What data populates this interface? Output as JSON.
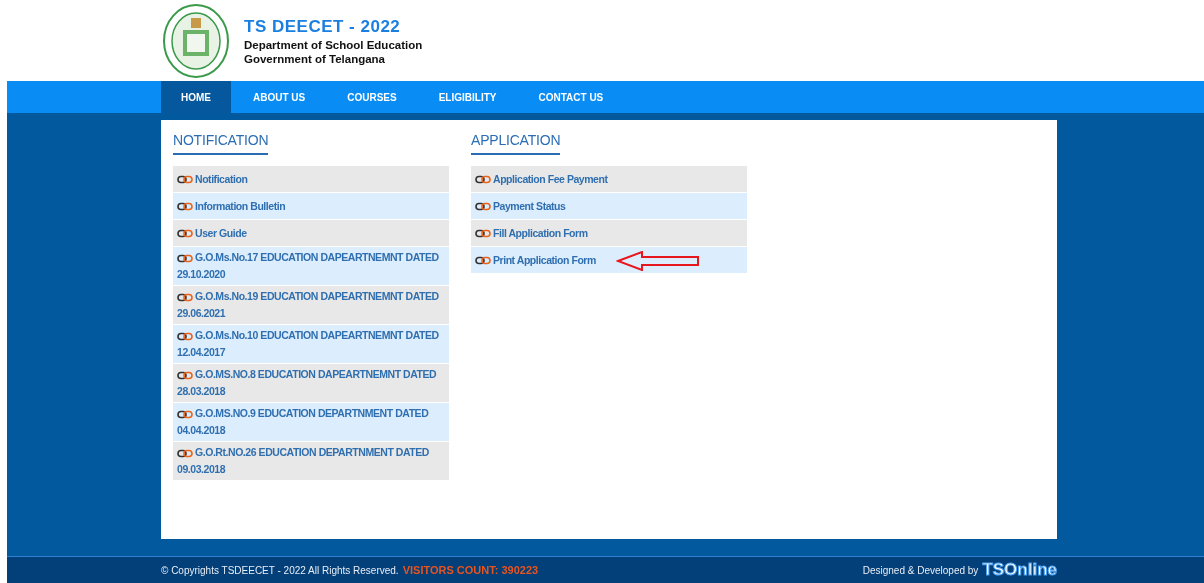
{
  "header": {
    "title": "TS DEECET - 2022",
    "subtitle_1": "Department of School Education",
    "subtitle_2": "Government of Telangana"
  },
  "nav": [
    {
      "label": "HOME",
      "selected": true
    },
    {
      "label": "ABOUT US",
      "selected": false
    },
    {
      "label": "COURSES",
      "selected": false
    },
    {
      "label": "ELIGIBILITY",
      "selected": false
    },
    {
      "label": "CONTACT US",
      "selected": false
    }
  ],
  "sections": [
    {
      "heading": "NOTIFICATION",
      "links": [
        {
          "label": "Notification",
          "marked": false
        },
        {
          "label": "Information Bulletin",
          "marked": false
        },
        {
          "label": "User Guide",
          "marked": false
        },
        {
          "label": "G.O.Ms.No.17 EDUCATION DAPEARTNEMNT DATED 29.10.2020",
          "marked": false
        },
        {
          "label": "G.O.Ms.No.19 EDUCATION DAPEARTNEMNT DATED 29.06.2021",
          "marked": false
        },
        {
          "label": "G.O.Ms.No.10 EDUCATION DAPEARTNEMNT DATED 12.04.2017",
          "marked": false
        },
        {
          "label": "G.O.MS.NO.8 EDUCATION DAPEARTNEMNT DATED 28.03.2018",
          "marked": false
        },
        {
          "label": "G.O.MS.NO.9 EDUCATION DEPARTNMENT DATED 04.04.2018",
          "marked": false
        },
        {
          "label": "G.O.Rt.NO.26 EDUCATION DEPARTNMENT DATED 09.03.2018",
          "marked": false
        }
      ]
    },
    {
      "heading": "APPLICATION",
      "links": [
        {
          "label": "Application Fee Payment",
          "marked": false
        },
        {
          "label": "Payment Status",
          "marked": false
        },
        {
          "label": "Fill Application Form",
          "marked": false
        },
        {
          "label": "Print Application Form",
          "marked": true
        }
      ]
    }
  ],
  "footer": {
    "copyright": "© Copyrights TSDEECET - 2022 All Rights Reserved.",
    "visitors": "VISITORS COUNT: 390223",
    "credit": "Designed & Developed by",
    "brand": "TSOnline"
  }
}
